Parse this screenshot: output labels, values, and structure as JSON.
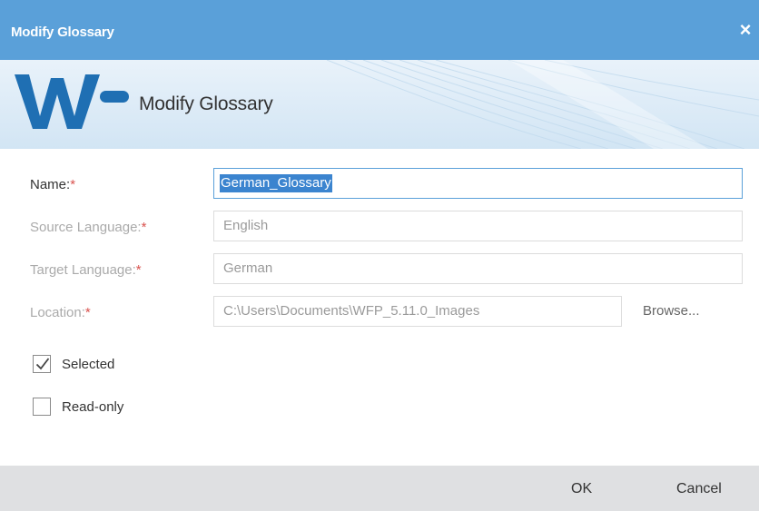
{
  "dialog": {
    "title": "Modify Glossary",
    "close_glyph": "×",
    "heading": "Modify Glossary"
  },
  "form": {
    "name": {
      "label": "Name:",
      "required": "*",
      "value": "German_Glossary"
    },
    "source_language": {
      "label": "Source Language:",
      "required": "*",
      "value": "English"
    },
    "target_language": {
      "label": "Target Language:",
      "required": "*",
      "value": "German"
    },
    "location": {
      "label": "Location:",
      "required": "*",
      "value": "C:\\Users\\Documents\\WFP_5.11.0_Images",
      "browse_label": "Browse..."
    },
    "selected": {
      "label": "Selected",
      "checked": true
    },
    "read_only": {
      "label": "Read-only",
      "checked": false
    }
  },
  "footer": {
    "ok_label": "OK",
    "cancel_label": "Cancel"
  },
  "colors": {
    "titlebar": "#5aa0d9",
    "logo": "#1f6fb3",
    "required": "#d9534f",
    "selection": "#3b84cf",
    "footer": "#dfe0e2"
  },
  "icons": {
    "logo": "wf-logo-icon",
    "close": "close-icon",
    "check": "checkmark-icon"
  }
}
